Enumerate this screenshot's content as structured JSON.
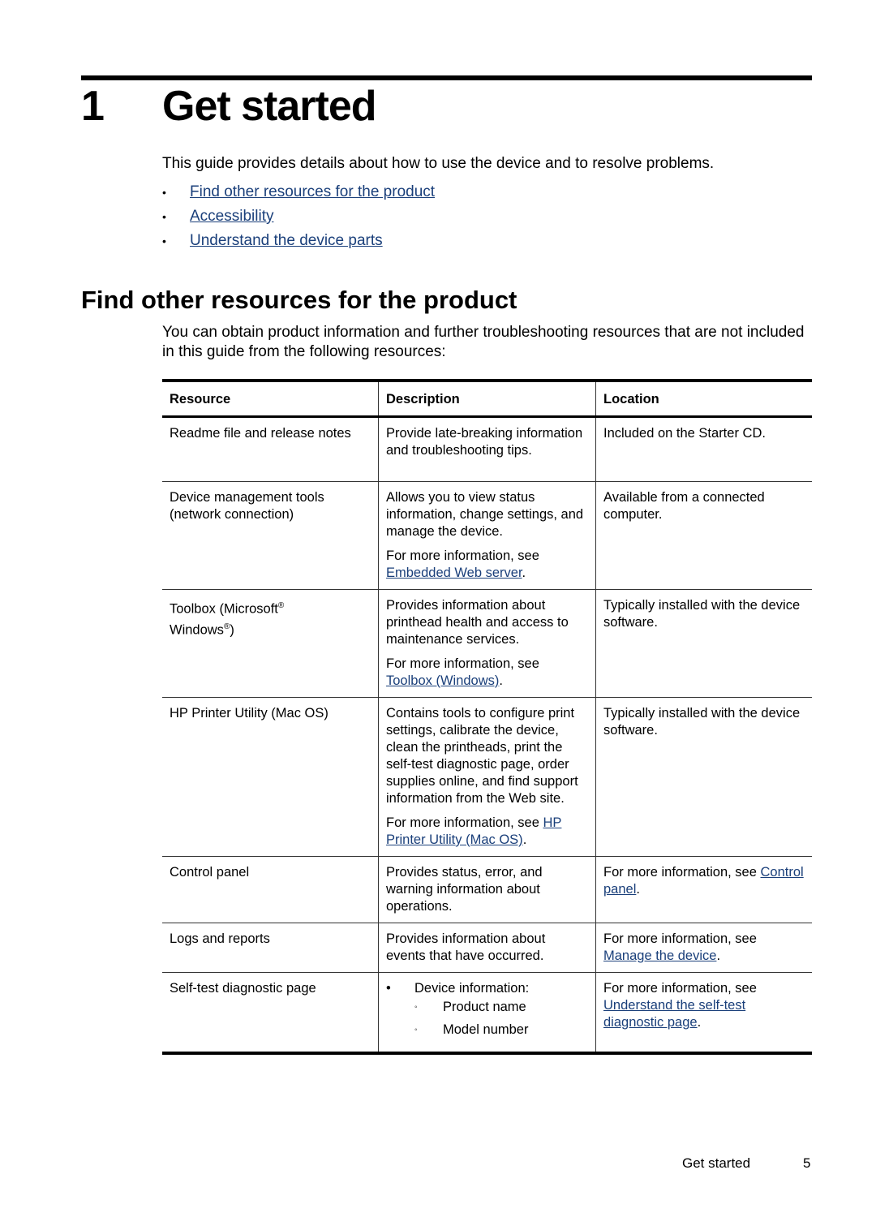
{
  "chapter": {
    "number": "1",
    "title": "Get started"
  },
  "intro": "This guide provides details about how to use the device and to resolve problems.",
  "toc": [
    {
      "bullet": "•",
      "label": "Find other resources for the product"
    },
    {
      "bullet": "•",
      "label": "Accessibility"
    },
    {
      "bullet": "•",
      "label": "Understand the device parts"
    }
  ],
  "section": {
    "title": "Find other resources for the product",
    "body": "You can obtain product information and further troubleshooting resources that are not included in this guide from the following resources:"
  },
  "table": {
    "headers": [
      "Resource",
      "Description",
      "Location"
    ],
    "rows": [
      {
        "resource": "Readme file and release notes",
        "description": "Provide late-breaking information and troubleshooting tips.",
        "location": "Included on the Starter CD."
      },
      {
        "resource": "Device management tools (network connection)",
        "description": "Allows you to view status information, change settings, and manage the device.",
        "more": "For more information, see ",
        "more_link": "Embedded Web server",
        "location": "Available from a connected computer."
      },
      {
        "resource_a": "Toolbox (Microsoft",
        "reg": "®",
        "resource_b": "Windows",
        "resource_c": ")",
        "description": "Provides information about printhead health and access to maintenance services.",
        "more": "For more information, see ",
        "more_link": "Toolbox (Windows)",
        "location": "Typically installed with the device software."
      },
      {
        "resource": "HP Printer Utility (Mac OS)",
        "description": "Contains tools to configure print settings, calibrate the device, clean the printheads, print the self-test diagnostic page, order supplies online, and find support information from the Web site.",
        "more": "For more information, see ",
        "more_link": "HP Printer Utility (Mac OS)",
        "location": "Typically installed with the device software."
      },
      {
        "resource": "Control panel",
        "description": "Provides status, error, and warning information about operations.",
        "location_prefix": "For more information, see ",
        "location_link": "Control panel"
      },
      {
        "resource": "Logs and reports",
        "description": "Provides information about events that have occurred.",
        "location_prefix": "For more information, see ",
        "location_link": "Manage the device"
      },
      {
        "resource": "Self-test diagnostic page",
        "bullet": "•",
        "description": "Device information:",
        "sub_bullet": "◦",
        "sub_items": [
          "Product name",
          "Model number"
        ],
        "location_prefix": "For more information, see ",
        "location_link": "Understand the self-test diagnostic page"
      }
    ]
  },
  "footer": {
    "title": "Get started",
    "page": "5"
  },
  "colors": {
    "link": "#1a3f7a"
  }
}
